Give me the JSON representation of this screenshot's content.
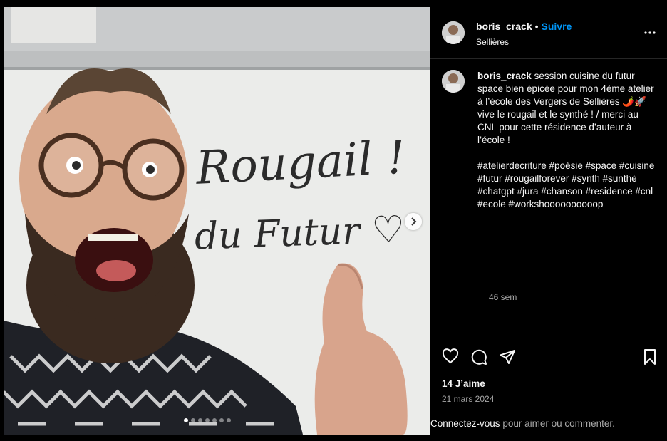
{
  "post": {
    "username": "boris_crack",
    "separator": "•",
    "follow_label": "Suivre",
    "location": "Sellières",
    "caption_text": "session cuisine du futur space bien épicée pour mon 4ème atelier à l’école des Vergers de Sellières 🌶️🚀 vive le rougail et le synthé ! / merci au CNL pour cette résidence d’auteur à l’école !\n\n#atelierdecriture #poésie #space #cuisine #futur #rougailforever #synth #sunthé #chatgpt #jura #chanson #residence #cnl #ecole #workshoooooooooop",
    "age": "46 sem",
    "likes": "14 J’aime",
    "date": "21 mars 2024",
    "login_link": "Connectez-vous",
    "login_rest": " pour aimer ou commenter."
  },
  "photo": {
    "board_line1": "Rougail !",
    "board_line2": "du Futur ♡",
    "carousel_count": 7,
    "carousel_active": 0
  },
  "icons": {
    "more": "more-options-icon",
    "like": "heart-icon",
    "comment": "comment-icon",
    "share": "share-icon",
    "save": "bookmark-icon",
    "next": "chevron-right-icon"
  },
  "colors": {
    "background": "#000000",
    "link_blue": "#0095f6",
    "muted": "#a8a8a8",
    "divider": "#262626"
  }
}
